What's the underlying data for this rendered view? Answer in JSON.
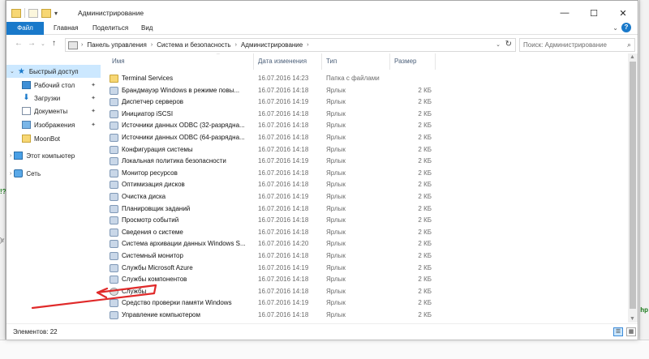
{
  "window": {
    "title": "Администрирование",
    "controls": {
      "minimize": "—",
      "maximize": "☐",
      "close": "✕"
    }
  },
  "ribbon": {
    "tabs": [
      "Файл",
      "Главная",
      "Поделиться",
      "Вид"
    ],
    "help": "?"
  },
  "addressbar": {
    "crumbs": [
      "Панель управления",
      "Система и безопасность",
      "Администрирование"
    ],
    "search_placeholder": "Поиск: Администрирование"
  },
  "navigation": {
    "quick_access": "Быстрый доступ",
    "items": [
      {
        "label": "Рабочий стол",
        "icon": "desktop-icon",
        "pinned": true
      },
      {
        "label": "Загрузки",
        "icon": "downloads-icon",
        "pinned": true
      },
      {
        "label": "Документы",
        "icon": "documents-icon",
        "pinned": true
      },
      {
        "label": "Изображения",
        "icon": "pictures-icon",
        "pinned": true
      },
      {
        "label": "MoonBot",
        "icon": "folder-icon",
        "pinned": false
      }
    ],
    "this_pc": "Этот компьютер",
    "network": "Сеть"
  },
  "columns": {
    "name": "Имя",
    "date": "Дата изменения",
    "type": "Тип",
    "size": "Размер"
  },
  "files": [
    {
      "name": "Terminal Services",
      "date": "16.07.2016 14:23",
      "type": "Папка с файлами",
      "size": "",
      "icon": "folder"
    },
    {
      "name": "Брандмауэр Windows в режиме повы...",
      "date": "16.07.2016 14:18",
      "type": "Ярлык",
      "size": "2 КБ",
      "icon": "shortcut"
    },
    {
      "name": "Диспетчер серверов",
      "date": "16.07.2016 14:19",
      "type": "Ярлык",
      "size": "2 КБ",
      "icon": "shortcut"
    },
    {
      "name": "Инициатор iSCSI",
      "date": "16.07.2016 14:18",
      "type": "Ярлык",
      "size": "2 КБ",
      "icon": "shortcut"
    },
    {
      "name": "Источники данных ODBC (32-разрядна...",
      "date": "16.07.2016 14:18",
      "type": "Ярлык",
      "size": "2 КБ",
      "icon": "shortcut"
    },
    {
      "name": "Источники данных ODBC (64-разрядна...",
      "date": "16.07.2016 14:18",
      "type": "Ярлык",
      "size": "2 КБ",
      "icon": "shortcut"
    },
    {
      "name": "Конфигурация системы",
      "date": "16.07.2016 14:18",
      "type": "Ярлык",
      "size": "2 КБ",
      "icon": "shortcut"
    },
    {
      "name": "Локальная политика безопасности",
      "date": "16.07.2016 14:19",
      "type": "Ярлык",
      "size": "2 КБ",
      "icon": "shortcut"
    },
    {
      "name": "Монитор ресурсов",
      "date": "16.07.2016 14:18",
      "type": "Ярлык",
      "size": "2 КБ",
      "icon": "shortcut"
    },
    {
      "name": "Оптимизация дисков",
      "date": "16.07.2016 14:18",
      "type": "Ярлык",
      "size": "2 КБ",
      "icon": "shortcut"
    },
    {
      "name": "Очистка диска",
      "date": "16.07.2016 14:19",
      "type": "Ярлык",
      "size": "2 КБ",
      "icon": "shortcut"
    },
    {
      "name": "Планировщик заданий",
      "date": "16.07.2016 14:18",
      "type": "Ярлык",
      "size": "2 КБ",
      "icon": "shortcut"
    },
    {
      "name": "Просмотр событий",
      "date": "16.07.2016 14:18",
      "type": "Ярлык",
      "size": "2 КБ",
      "icon": "shortcut"
    },
    {
      "name": "Сведения о системе",
      "date": "16.07.2016 14:18",
      "type": "Ярлык",
      "size": "2 КБ",
      "icon": "shortcut"
    },
    {
      "name": "Система архивации данных Windows S...",
      "date": "16.07.2016 14:20",
      "type": "Ярлык",
      "size": "2 КБ",
      "icon": "shortcut"
    },
    {
      "name": "Системный монитор",
      "date": "16.07.2016 14:18",
      "type": "Ярлык",
      "size": "2 КБ",
      "icon": "shortcut"
    },
    {
      "name": "Службы Microsoft Azure",
      "date": "16.07.2016 14:19",
      "type": "Ярлык",
      "size": "2 КБ",
      "icon": "shortcut"
    },
    {
      "name": "Службы компонентов",
      "date": "16.07.2016 14:18",
      "type": "Ярлык",
      "size": "2 КБ",
      "icon": "shortcut"
    },
    {
      "name": "Службы",
      "date": "16.07.2016 14:18",
      "type": "Ярлык",
      "size": "2 КБ",
      "icon": "gear"
    },
    {
      "name": "Средство проверки памяти Windows",
      "date": "16.07.2016 14:19",
      "type": "Ярлык",
      "size": "2 КБ",
      "icon": "shortcut"
    },
    {
      "name": "Управление компьютером",
      "date": "16.07.2016 14:18",
      "type": "Ярлык",
      "size": "2 КБ",
      "icon": "shortcut"
    },
    {
      "name": "",
      "date": "16.07.2016 14:18",
      "type": "Ярлык",
      "size": "2 КБ",
      "icon": "shortcut"
    }
  ],
  "status": {
    "items": "Элементов: 22"
  },
  "colors": {
    "accent": "#1979ca",
    "selection": "#cce8ff",
    "annotation": "#e02a2a"
  }
}
